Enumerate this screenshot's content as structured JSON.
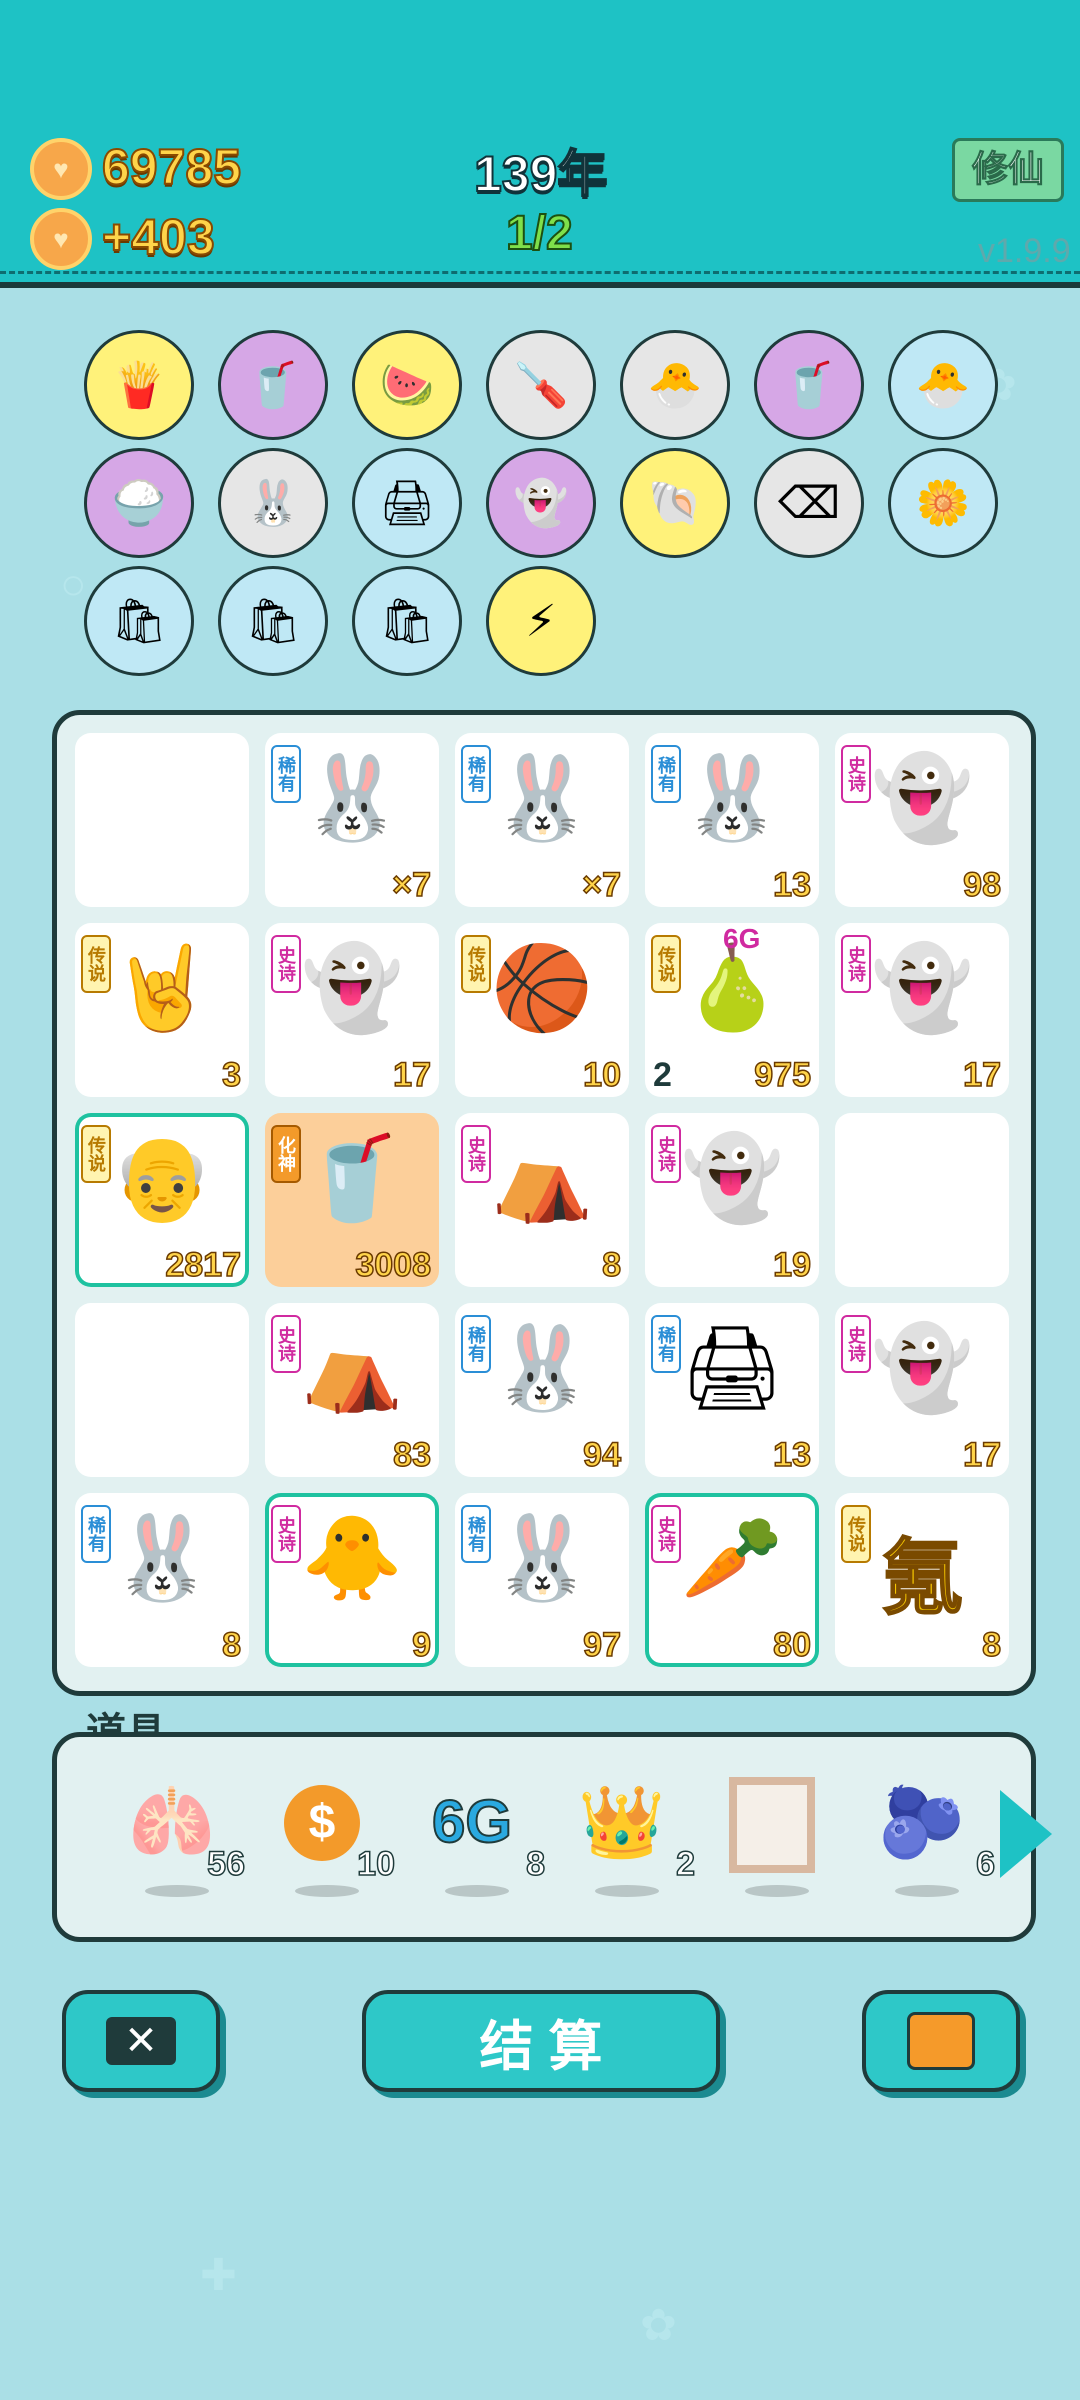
{
  "header": {
    "coins": "69785",
    "income": "+403",
    "year": "139年",
    "stage": "1/2",
    "xiuxian_label": "修仙",
    "version": "v1.9.9"
  },
  "buffs": [
    {
      "name": "fries-icon",
      "emoji": "🍟",
      "bg": "#fff27a"
    },
    {
      "name": "bubble-tea-icon",
      "emoji": "🥤",
      "bg": "#d6a7e6"
    },
    {
      "name": "fruit-plate-icon",
      "emoji": "🍉",
      "bg": "#fff27a"
    },
    {
      "name": "screwdriver-icon",
      "emoji": "🪛",
      "bg": "#e6e6e6"
    },
    {
      "name": "chick-egg-icon",
      "emoji": "🐣",
      "bg": "#e6e6e6"
    },
    {
      "name": "bubble-tea-icon",
      "emoji": "🥤",
      "bg": "#d6a7e6"
    },
    {
      "name": "chick-egg-icon",
      "emoji": "🐣",
      "bg": "#bfe8f5"
    },
    {
      "name": "rice-bowl-icon",
      "emoji": "🍚",
      "bg": "#d6a7e6"
    },
    {
      "name": "rabbit-icon",
      "emoji": "🐰",
      "bg": "#e6e6e6"
    },
    {
      "name": "printer-icon",
      "emoji": "🖨",
      "bg": "#bfe8f5"
    },
    {
      "name": "ghost-icon",
      "emoji": "👻",
      "bg": "#d6a7e6"
    },
    {
      "name": "shell-icon",
      "emoji": "🐚",
      "bg": "#fff27a"
    },
    {
      "name": "delete-tag-icon",
      "emoji": "⌫",
      "bg": "#e6e6e6"
    },
    {
      "name": "flower-pot-icon",
      "emoji": "🌼",
      "bg": "#bfe8f5"
    },
    {
      "name": "trash-bag-icon",
      "emoji": "🛍",
      "bg": "#bfe8f5"
    },
    {
      "name": "trash-bag-icon",
      "emoji": "🛍",
      "bg": "#bfe8f5"
    },
    {
      "name": "trash-bag-icon",
      "emoji": "🛍",
      "bg": "#bfe8f5"
    },
    {
      "name": "lightning-icon",
      "emoji": "⚡",
      "bg": "#fff27a"
    }
  ],
  "grid": [
    {
      "badge": "",
      "icon": "",
      "count": ""
    },
    {
      "badge": "稀有",
      "icon": "🐰",
      "count": "×7"
    },
    {
      "badge": "稀有",
      "icon": "🐰",
      "count": "×7"
    },
    {
      "badge": "稀有",
      "icon": "🐰",
      "count": "13"
    },
    {
      "badge": "史诗",
      "icon": "👻",
      "count": "98"
    },
    {
      "badge": "传说",
      "icon": "🤘",
      "count": "3"
    },
    {
      "badge": "史诗",
      "icon": "👻",
      "count": "17"
    },
    {
      "badge": "传说",
      "icon": "🏀",
      "count": "10"
    },
    {
      "badge": "传说",
      "icon": "🍐",
      "count": "975",
      "left": "2",
      "tag": "6G"
    },
    {
      "badge": "史诗",
      "icon": "👻",
      "count": "17"
    },
    {
      "badge": "传说",
      "icon": "👴",
      "count": "2817"
    },
    {
      "badge": "化神",
      "icon": "🥤",
      "count": "3008"
    },
    {
      "badge": "史诗",
      "icon": "⛺",
      "count": "8"
    },
    {
      "badge": "史诗",
      "icon": "👻",
      "count": "19"
    },
    {
      "badge": "",
      "icon": "",
      "count": ""
    },
    {
      "badge": "",
      "icon": "",
      "count": ""
    },
    {
      "badge": "史诗",
      "icon": "⛺",
      "count": "83"
    },
    {
      "badge": "稀有",
      "icon": "🐰",
      "count": "94"
    },
    {
      "badge": "稀有",
      "icon": "🖨",
      "count": "13"
    },
    {
      "badge": "史诗",
      "icon": "👻",
      "count": "17"
    },
    {
      "badge": "稀有",
      "icon": "🐰",
      "count": "8"
    },
    {
      "badge": "史诗",
      "icon": "🐥",
      "count": "9"
    },
    {
      "badge": "稀有",
      "icon": "🐰",
      "count": "97"
    },
    {
      "badge": "史诗",
      "icon": "🥕",
      "count": "80"
    },
    {
      "badge": "传说",
      "icon": "氪",
      "count": "8"
    }
  ],
  "props": {
    "label": "道具",
    "items": [
      {
        "name": "liver-icon",
        "icon": "🫁",
        "count": "56"
      },
      {
        "name": "dollar-coin-icon",
        "icon": "$",
        "count": "10"
      },
      {
        "name": "6g-icon",
        "icon": "6G",
        "count": "8"
      },
      {
        "name": "crown-icon",
        "icon": "👑",
        "count": "2"
      },
      {
        "name": "frame-icon",
        "icon": "▢",
        "count": ""
      },
      {
        "name": "blueberry-icon",
        "icon": "🫐",
        "count": "6"
      }
    ]
  },
  "buttons": {
    "settle": "结 算"
  }
}
